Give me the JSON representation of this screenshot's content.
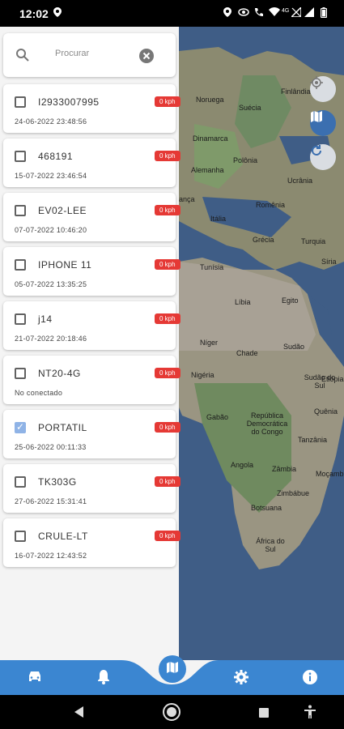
{
  "status_bar": {
    "time": "12:02",
    "network_label": "4G"
  },
  "search": {
    "placeholder": "Procurar"
  },
  "devices": [
    {
      "name": "I2933007995",
      "speed": "0 kph",
      "date": "24-06-2022 23:48:56",
      "checked": false
    },
    {
      "name": "468191",
      "speed": "0 kph",
      "date": "15-07-2022 23:46:54",
      "checked": false
    },
    {
      "name": "EV02-LEE",
      "speed": "0 kph",
      "date": "07-07-2022 10:46:20",
      "checked": false
    },
    {
      "name": "IPHONE 11",
      "speed": "0 kph",
      "date": "05-07-2022 13:35:25",
      "checked": false
    },
    {
      "name": "j14",
      "speed": "0 kph",
      "date": "21-07-2022 20:18:46",
      "checked": false
    },
    {
      "name": "NT20-4G",
      "speed": "0 kph",
      "date": "No conectado",
      "checked": false
    },
    {
      "name": "PORTATIL",
      "speed": "0 kph",
      "date": "25-06-2022 00:11:33",
      "checked": true
    },
    {
      "name": "TK303G",
      "speed": "0 kph",
      "date": "27-06-2022 15:31:41",
      "checked": false
    },
    {
      "name": "CRULE-LT",
      "speed": "0 kph",
      "date": "16-07-2022 12:43:52",
      "checked": false
    }
  ],
  "map_labels": {
    "finlandia": "Finlândia",
    "noruega": "Noruega",
    "suecia": "Suécia",
    "dinamarca": "Dinamarca",
    "polonia": "Polônia",
    "alemanha": "Alemanha",
    "ucrania": "Ucrânia",
    "franca": "ança",
    "romenia": "Romênia",
    "italia": "Itália",
    "grecia": "Grécia",
    "turquia": "Turquia",
    "tunisia": "Tunísia",
    "siria": "Síria",
    "libia": "Líbia",
    "egito": "Egito",
    "niger": "Níger",
    "chade": "Chade",
    "sudao": "Sudão",
    "nigeria": "Nigéria",
    "sudao_do_sul": "Sudão do Sul",
    "etiopia": "Etiópia",
    "gabao": "Gabão",
    "rdc": "República Democrática do Congo",
    "quenia": "Quênia",
    "tanzania": "Tanzânia",
    "angola": "Angola",
    "zambia": "Zâmbia",
    "mocambique": "Moçamb",
    "zimbabue": "Zimbábue",
    "botsuana": "Botsuana",
    "africa_do_sul": "África do Sul"
  },
  "colors": {
    "accent": "#3b86d1",
    "speed_badge": "#e53935",
    "checkbox_checked": "#8fb3e6",
    "map_water": "#3f5d86",
    "map_land": "#8a8a7a"
  },
  "icons": {
    "search": "search-icon",
    "clear": "clear-icon",
    "locate": "locate-icon",
    "map_layers": "map-icon",
    "refresh": "refresh-icon",
    "car": "car-icon",
    "bell": "bell-icon",
    "center_map": "map-icon",
    "settings": "gear-icon",
    "info": "info-icon"
  }
}
